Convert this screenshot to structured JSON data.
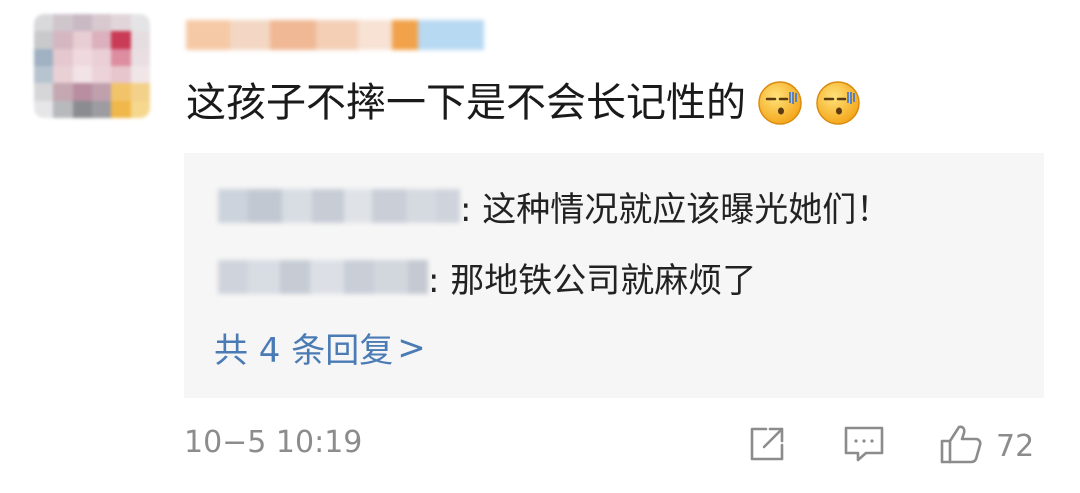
{
  "comment": {
    "text": "这孩子不摔一下是不会长记性的"
  },
  "replies": [
    {
      "text": ": 这种情况就应该曝光她们！"
    },
    {
      "text": ": 那地铁公司就麻烦了"
    }
  ],
  "more_replies": {
    "label": "共 4 条回复",
    "chevron": ">"
  },
  "footer": {
    "timestamp": "10−5 10:19",
    "like_count": "72"
  },
  "icons": {
    "emoji": "smirk-emoji-icon",
    "share": "share-icon",
    "comment": "comment-icon",
    "like": "thumbs-up-icon"
  },
  "colors": {
    "background": "#ffffff",
    "reply_background": "#f6f6f6",
    "link": "#4a7bb5",
    "meta_text": "#8c8c8c"
  }
}
